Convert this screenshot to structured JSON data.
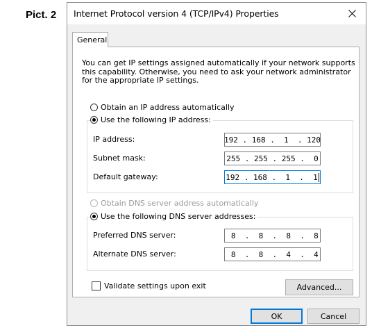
{
  "figure_label": "Pict. 2",
  "window": {
    "title": "Internet Protocol version  4 (TCP/IPv4) Properties"
  },
  "tabs": [
    {
      "label": "General"
    }
  ],
  "description": "You can get IP settings assigned automatically if your network supports this capability. Otherwise, you need to ask your network administrator for the appropriate IP settings.",
  "ip_section": {
    "auto_label": "Obtain an IP address automatically",
    "manual_label": "Use the following IP address:",
    "selected": "manual",
    "fields": [
      {
        "label": "IP address:",
        "value": "192 . 168 .  1  . 120"
      },
      {
        "label": "Subnet mask:",
        "value": "255 . 255 . 255 .  0"
      },
      {
        "label": "Default gateway:",
        "value": "192 . 168 .  1  .  1"
      }
    ]
  },
  "dns_section": {
    "auto_label": "Obtain DNS server address automatically",
    "manual_label": "Use the following DNS server addresses:",
    "selected": "manual",
    "auto_disabled": true,
    "fields": [
      {
        "label": "Preferred DNS server:",
        "value": " 8  .  8  .  8  .  8"
      },
      {
        "label": "Alternate DNS server:",
        "value": " 8  .  8  .  4  .  4"
      }
    ]
  },
  "validate_label": "Validate settings upon exit",
  "validate_checked": false,
  "buttons": {
    "advanced": "Advanced...",
    "ok": "OK",
    "cancel": "Cancel"
  },
  "colors": {
    "focus_accent": "#0078d7",
    "window_bg": "#f0f0f0"
  }
}
